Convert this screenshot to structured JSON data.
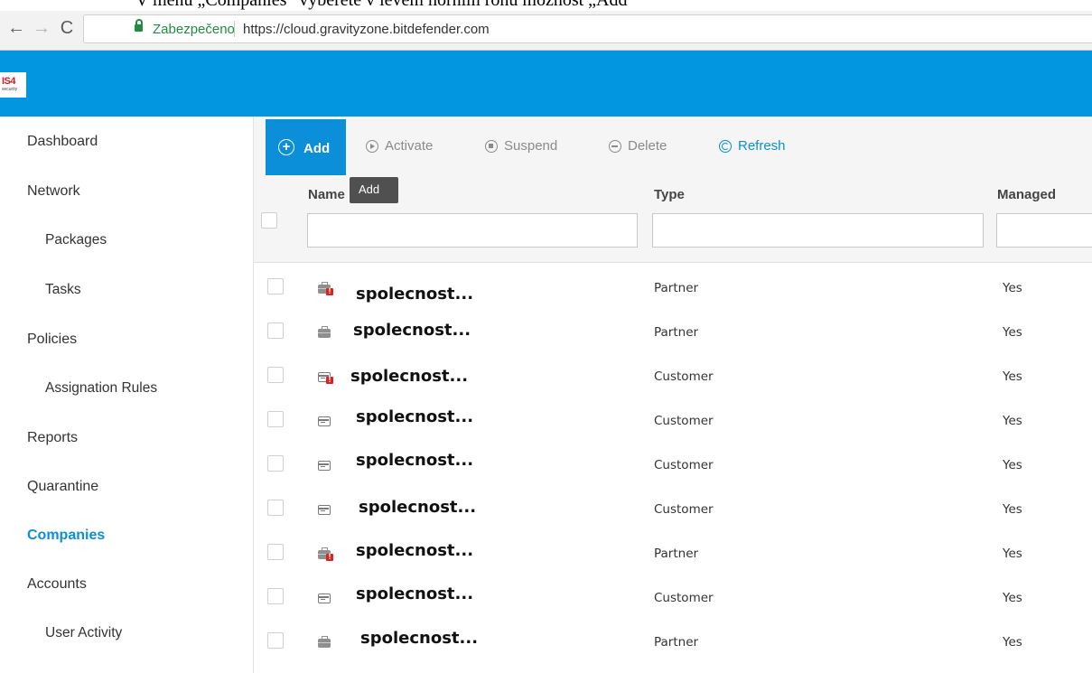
{
  "doc_caption": "V menu „Companies“ vyberete v levém horním rohu možnost „Add“",
  "browser": {
    "back_glyph": "←",
    "forward_glyph": "→",
    "reload_glyph": "C",
    "secure_label": "Zabezpečeno",
    "url": "https://cloud.gravityzone.bitdefender.com"
  },
  "app": {
    "header_color": "#0296e0",
    "accent_color": "#0a8fd8",
    "logo_main": "IS4",
    "logo_sub": "security"
  },
  "sidebar": {
    "items": [
      {
        "label": "Dashboard"
      },
      {
        "label": "Network"
      },
      {
        "label": "Packages"
      },
      {
        "label": "Tasks"
      },
      {
        "label": "Policies"
      },
      {
        "label": "Assignation Rules"
      },
      {
        "label": "Reports"
      },
      {
        "label": "Quarantine"
      },
      {
        "label": "Companies",
        "active": true
      },
      {
        "label": "Accounts"
      },
      {
        "label": "User Activity"
      }
    ]
  },
  "toolbar": {
    "add": "Add",
    "activate": "Activate",
    "suspend": "Suspend",
    "delete": "Delete",
    "refresh": "Refresh",
    "tooltip": "Add"
  },
  "grid": {
    "columns": {
      "name": "Name",
      "type": "Type",
      "managed": "Managed"
    },
    "filters": {
      "name": "",
      "type": "",
      "managed": ""
    },
    "rows": [
      {
        "icon": "partner-alert-icon",
        "name": "spolecnost...",
        "type": "Partner",
        "managed": "Yes"
      },
      {
        "icon": "partner-icon",
        "name": "spolecnost...",
        "type": "Partner",
        "managed": "Yes"
      },
      {
        "icon": "customer-alert-icon",
        "name": "spolecnost...",
        "type": "Customer",
        "managed": "Yes"
      },
      {
        "icon": "customer-icon",
        "name": "spolecnost...",
        "type": "Customer",
        "managed": "Yes"
      },
      {
        "icon": "customer-icon",
        "name": "spolecnost...",
        "type": "Customer",
        "managed": "Yes"
      },
      {
        "icon": "customer-icon",
        "name": "spolecnost...",
        "type": "Customer",
        "managed": "Yes"
      },
      {
        "icon": "partner-alert-icon",
        "name": "spolecnost...",
        "type": "Partner",
        "managed": "Yes"
      },
      {
        "icon": "customer-icon",
        "name": "spolecnost...",
        "type": "Customer",
        "managed": "Yes"
      },
      {
        "icon": "partner-icon",
        "name": "spolecnost...",
        "type": "Partner",
        "managed": "Yes"
      }
    ]
  }
}
